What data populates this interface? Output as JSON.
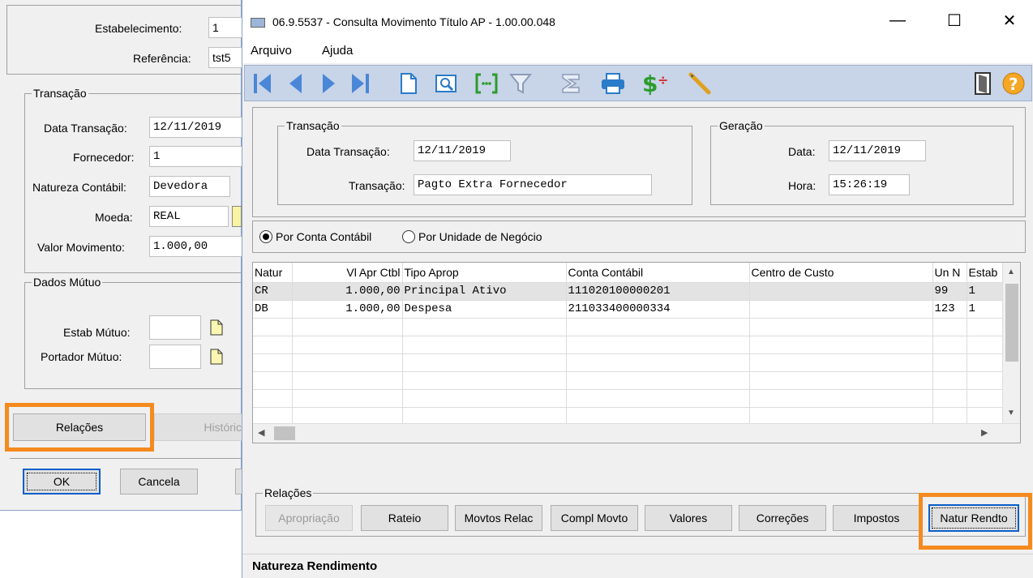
{
  "back_window": {
    "estabelecimento_label": "Estabelecimento:",
    "estabelecimento_value": "1",
    "referencia_label": "Referência:",
    "referencia_value": "tst5",
    "transacao_group": "Transação",
    "data_transacao_label": "Data Transação:",
    "data_transacao_value": "12/11/2019",
    "fornecedor_label": "Fornecedor:",
    "fornecedor_value": "1",
    "natureza_label": "Natureza Contábil:",
    "natureza_value": "Devedora",
    "moeda_label": "Moeda:",
    "moeda_value": "REAL",
    "valor_label": "Valor  Movimento:",
    "valor_value": "1.000,00",
    "dados_mutuo_group": "Dados Mútuo",
    "estab_mutuo_label": "Estab Mútuo:",
    "portador_mutuo_label": "Portador Mútuo:",
    "relacoes_button": "Relações",
    "historico_button": "Históric",
    "ok_button": "OK",
    "cancela_button": "Cancela"
  },
  "window": {
    "title": "06.9.5537 - Consulta Movimento Título AP - 1.00.00.048",
    "minimize": "—",
    "maximize": "☐",
    "close": "✕"
  },
  "menu": {
    "items": [
      "Arquivo",
      "Ajuda"
    ]
  },
  "toolbar": {
    "icons": [
      "first-icon",
      "prev-icon",
      "next-icon",
      "last-icon",
      "document-icon",
      "zoom-icon",
      "goto-icon",
      "filter-icon",
      "sum-icon",
      "print-icon",
      "currency-icon",
      "pencil-icon",
      "exit-door-icon",
      "help-icon"
    ]
  },
  "transacao": {
    "group": "Transação",
    "data_label": "Data Transação:",
    "data_value": "12/11/2019",
    "transacao_label": "Transação:",
    "transacao_value": "Pagto Extra Fornecedor"
  },
  "geracao": {
    "group": "Geração",
    "data_label": "Data:",
    "data_value": "12/11/2019",
    "hora_label": "Hora:",
    "hora_value": "15:26:19"
  },
  "radio": {
    "option1": "Por Conta Contábil",
    "option2": "Por Unidade de Negócio",
    "selected": "option1"
  },
  "grid": {
    "headers": [
      "Natur",
      "Vl Apr Ctbl",
      "Tipo Aprop",
      "Conta Contábil",
      "Centro de Custo",
      "Un N",
      "Estab"
    ],
    "rows": [
      [
        "CR",
        "1.000,00",
        "Principal Ativo",
        "111020100000201",
        "",
        "99",
        "1"
      ],
      [
        "DB",
        "1.000,00",
        "Despesa",
        "211033400000334",
        "",
        "123",
        "1"
      ]
    ]
  },
  "relacoes": {
    "group": "Relações",
    "buttons": [
      "Apropriação",
      "Rateio",
      "Movtos Relac",
      "Compl Movto",
      "Valores",
      "Correções",
      "Impostos",
      "Natur Rendto"
    ]
  },
  "status": {
    "text": "Natureza Rendimento"
  },
  "colors": {
    "highlight": "#f58a1f",
    "toolbar": "#c8d4e8",
    "icon_blue": "#2a7bc8"
  }
}
